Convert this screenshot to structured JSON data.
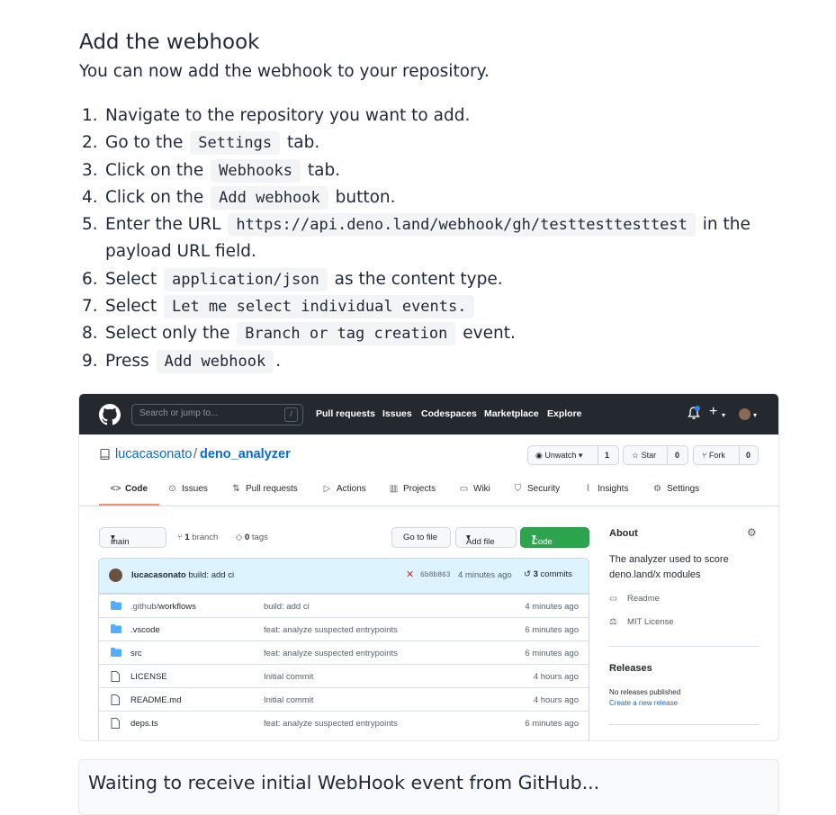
{
  "heading": "Add the webhook",
  "intro": "You can now add the webhook to your repository.",
  "steps": [
    {
      "num": "1.",
      "pre": "Navigate to the repository you want to add.",
      "code": "",
      "post": ""
    },
    {
      "num": "2.",
      "pre": "Go to the",
      "code": "Settings",
      "post": "tab."
    },
    {
      "num": "3.",
      "pre": "Click on the",
      "code": "Webhooks",
      "post": "tab."
    },
    {
      "num": "4.",
      "pre": "Click on the",
      "code": "Add webhook",
      "post": "button."
    },
    {
      "num": "5.",
      "pre": "Enter the URL",
      "code": "https://api.deno.land/webhook/gh/testtesttesttest",
      "post": "in the payload URL field."
    },
    {
      "num": "6.",
      "pre": "Select",
      "code": "application/json",
      "post": "as the content type."
    },
    {
      "num": "7.",
      "pre": "Select",
      "code": "Let me select individual events.",
      "post": ""
    },
    {
      "num": "8.",
      "pre": "Select only the",
      "code": "Branch or tag creation",
      "post": "event."
    },
    {
      "num": "9.",
      "pre": "Press",
      "code": "Add webhook",
      "post": "."
    }
  ],
  "github": {
    "search_placeholder": "Search or jump to...",
    "search_shortcut": "/",
    "nav": [
      "Pull requests",
      "Issues",
      "Codespaces",
      "Marketplace",
      "Explore"
    ],
    "repo_owner": "lucacasonato",
    "repo_sep": "/",
    "repo_name": "deno_analyzer",
    "unwatch_label": "Unwatch",
    "unwatch_count": "1",
    "star_label": "Star",
    "star_count": "0",
    "fork_label": "Fork",
    "fork_count": "0",
    "tabs": [
      "Code",
      "Issues",
      "Pull requests",
      "Actions",
      "Projects",
      "Wiki",
      "Security",
      "Insights",
      "Settings"
    ],
    "branch": "main",
    "branch_count": "1",
    "branch_word": "branch",
    "tag_count": "0",
    "tag_word": "tags",
    "go_to_file": "Go to file",
    "add_file": "Add file",
    "code_button": "Code",
    "commit": {
      "author": "lucacasonato",
      "message": "build: add ci",
      "sha": "6b8b863",
      "time": "4 minutes ago",
      "count": "3",
      "count_word": "commits"
    },
    "files": [
      {
        "type": "folder",
        "prefix": ".github/",
        "name": "workflows",
        "message": "build: add ci",
        "age": "4 minutes ago"
      },
      {
        "type": "folder",
        "prefix": "",
        "name": ".vscode",
        "message": "feat: analyze suspected entrypoints",
        "age": "6 minutes ago"
      },
      {
        "type": "folder",
        "prefix": "",
        "name": "src",
        "message": "feat: analyze suspected entrypoints",
        "age": "6 minutes ago"
      },
      {
        "type": "file",
        "prefix": "",
        "name": "LICENSE",
        "message": "Initial commit",
        "age": "4 hours ago"
      },
      {
        "type": "file",
        "prefix": "",
        "name": "README.md",
        "message": "Initial commit",
        "age": "4 hours ago"
      },
      {
        "type": "file",
        "prefix": "",
        "name": "deps.ts",
        "message": "feat: analyze suspected entrypoints",
        "age": "6 minutes ago"
      }
    ],
    "about_title": "About",
    "about_desc": "The analyzer used to score deno.land/x modules",
    "readme_label": "Readme",
    "license_label": "MIT License",
    "releases_title": "Releases",
    "no_releases": "No releases published",
    "create_release": "Create a new release"
  },
  "status_text": "Waiting to receive initial WebHook event from GitHub...",
  "colors": {
    "header_bg": "#24292f",
    "link_blue": "#0969da",
    "code_green": "#2da44e",
    "commit_bar": "#ddf4ff",
    "folder_blue": "#54aeff",
    "active_tab_underline": "#fd8c73"
  }
}
